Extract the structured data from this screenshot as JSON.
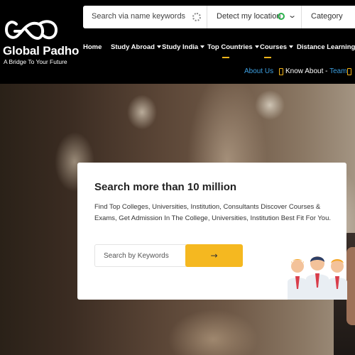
{
  "brand": {
    "name": "Global Padho",
    "tagline": "A Bridge To Your Future"
  },
  "search_bar": {
    "keyword_placeholder": "Search via name keywords",
    "location_label": "Detect my location",
    "category_label": "Category"
  },
  "nav": {
    "items": [
      {
        "label": "Home",
        "dropdown": false
      },
      {
        "label": "Study Abroad",
        "dropdown": true
      },
      {
        "label": "Study India",
        "dropdown": true
      },
      {
        "label": "Top Countries",
        "dropdown": true
      },
      {
        "label": "Courses",
        "dropdown": true
      },
      {
        "label": "Distance Learning",
        "dropdown": false
      }
    ]
  },
  "sub_links": {
    "about": "About Us",
    "know_about": "Know About",
    "separator": "-",
    "team": "Team"
  },
  "hero_card": {
    "title": "Search more than 10 million",
    "description": "Find Top Colleges, Universities, Institution, Consultants Discover Courses & Exams, Get Admission In The College, Universities, Institution Best Fit For You.",
    "search_placeholder": "Search by Keywords",
    "search_button": "→"
  },
  "colors": {
    "accent": "#f5b820",
    "link": "#3d9fe0",
    "header_bg": "#000000"
  },
  "icons": [
    "logo-infinity-icon",
    "loader-icon",
    "target-icon",
    "chevron-down-icon",
    "phone-icon",
    "arrow-right-icon",
    "people-illustration"
  ]
}
